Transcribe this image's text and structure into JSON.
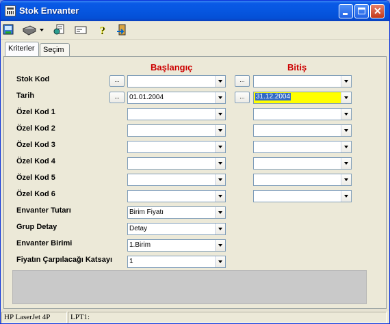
{
  "window": {
    "title": "Stok Envanter"
  },
  "toolbar": {
    "icons": [
      "export-icon",
      "print-icon",
      "report-icon",
      "card-icon",
      "help-icon",
      "exit-icon"
    ]
  },
  "tabs": [
    {
      "label": "Kriterler",
      "active": true
    },
    {
      "label": "Seçim",
      "active": false
    }
  ],
  "columns": {
    "start": "Başlangıç",
    "end": "Bitiş"
  },
  "range_rows": [
    {
      "label": "Stok Kod",
      "start": "",
      "end": ""
    },
    {
      "label": "Tarih",
      "start": "01.01.2004",
      "end": "31.12.2004"
    },
    {
      "label": "Özel Kod 1",
      "start": "",
      "end": ""
    },
    {
      "label": "Özel Kod 2",
      "start": "",
      "end": ""
    },
    {
      "label": "Özel Kod 3",
      "start": "",
      "end": ""
    },
    {
      "label": "Özel Kod 4",
      "start": "",
      "end": ""
    },
    {
      "label": "Özel Kod 5",
      "start": "",
      "end": ""
    },
    {
      "label": "Özel Kod 6",
      "start": "",
      "end": ""
    }
  ],
  "dots_label": "...",
  "single_rows": [
    {
      "label": "Envanter Tutarı",
      "value": "Birim Fiyatı"
    },
    {
      "label": "Grup Detay",
      "value": "Detay"
    },
    {
      "label": "Envanter Birimi",
      "value": "1.Birim"
    },
    {
      "label": "Fiyatın Çarpılacağı Katsayı",
      "value": "1"
    }
  ],
  "status": {
    "printer": "HP LaserJet 4P",
    "port": "LPT1:"
  },
  "colors": {
    "header_red": "#cc0000",
    "highlight_yellow": "#ffff00",
    "selection_blue": "#316ac5"
  }
}
